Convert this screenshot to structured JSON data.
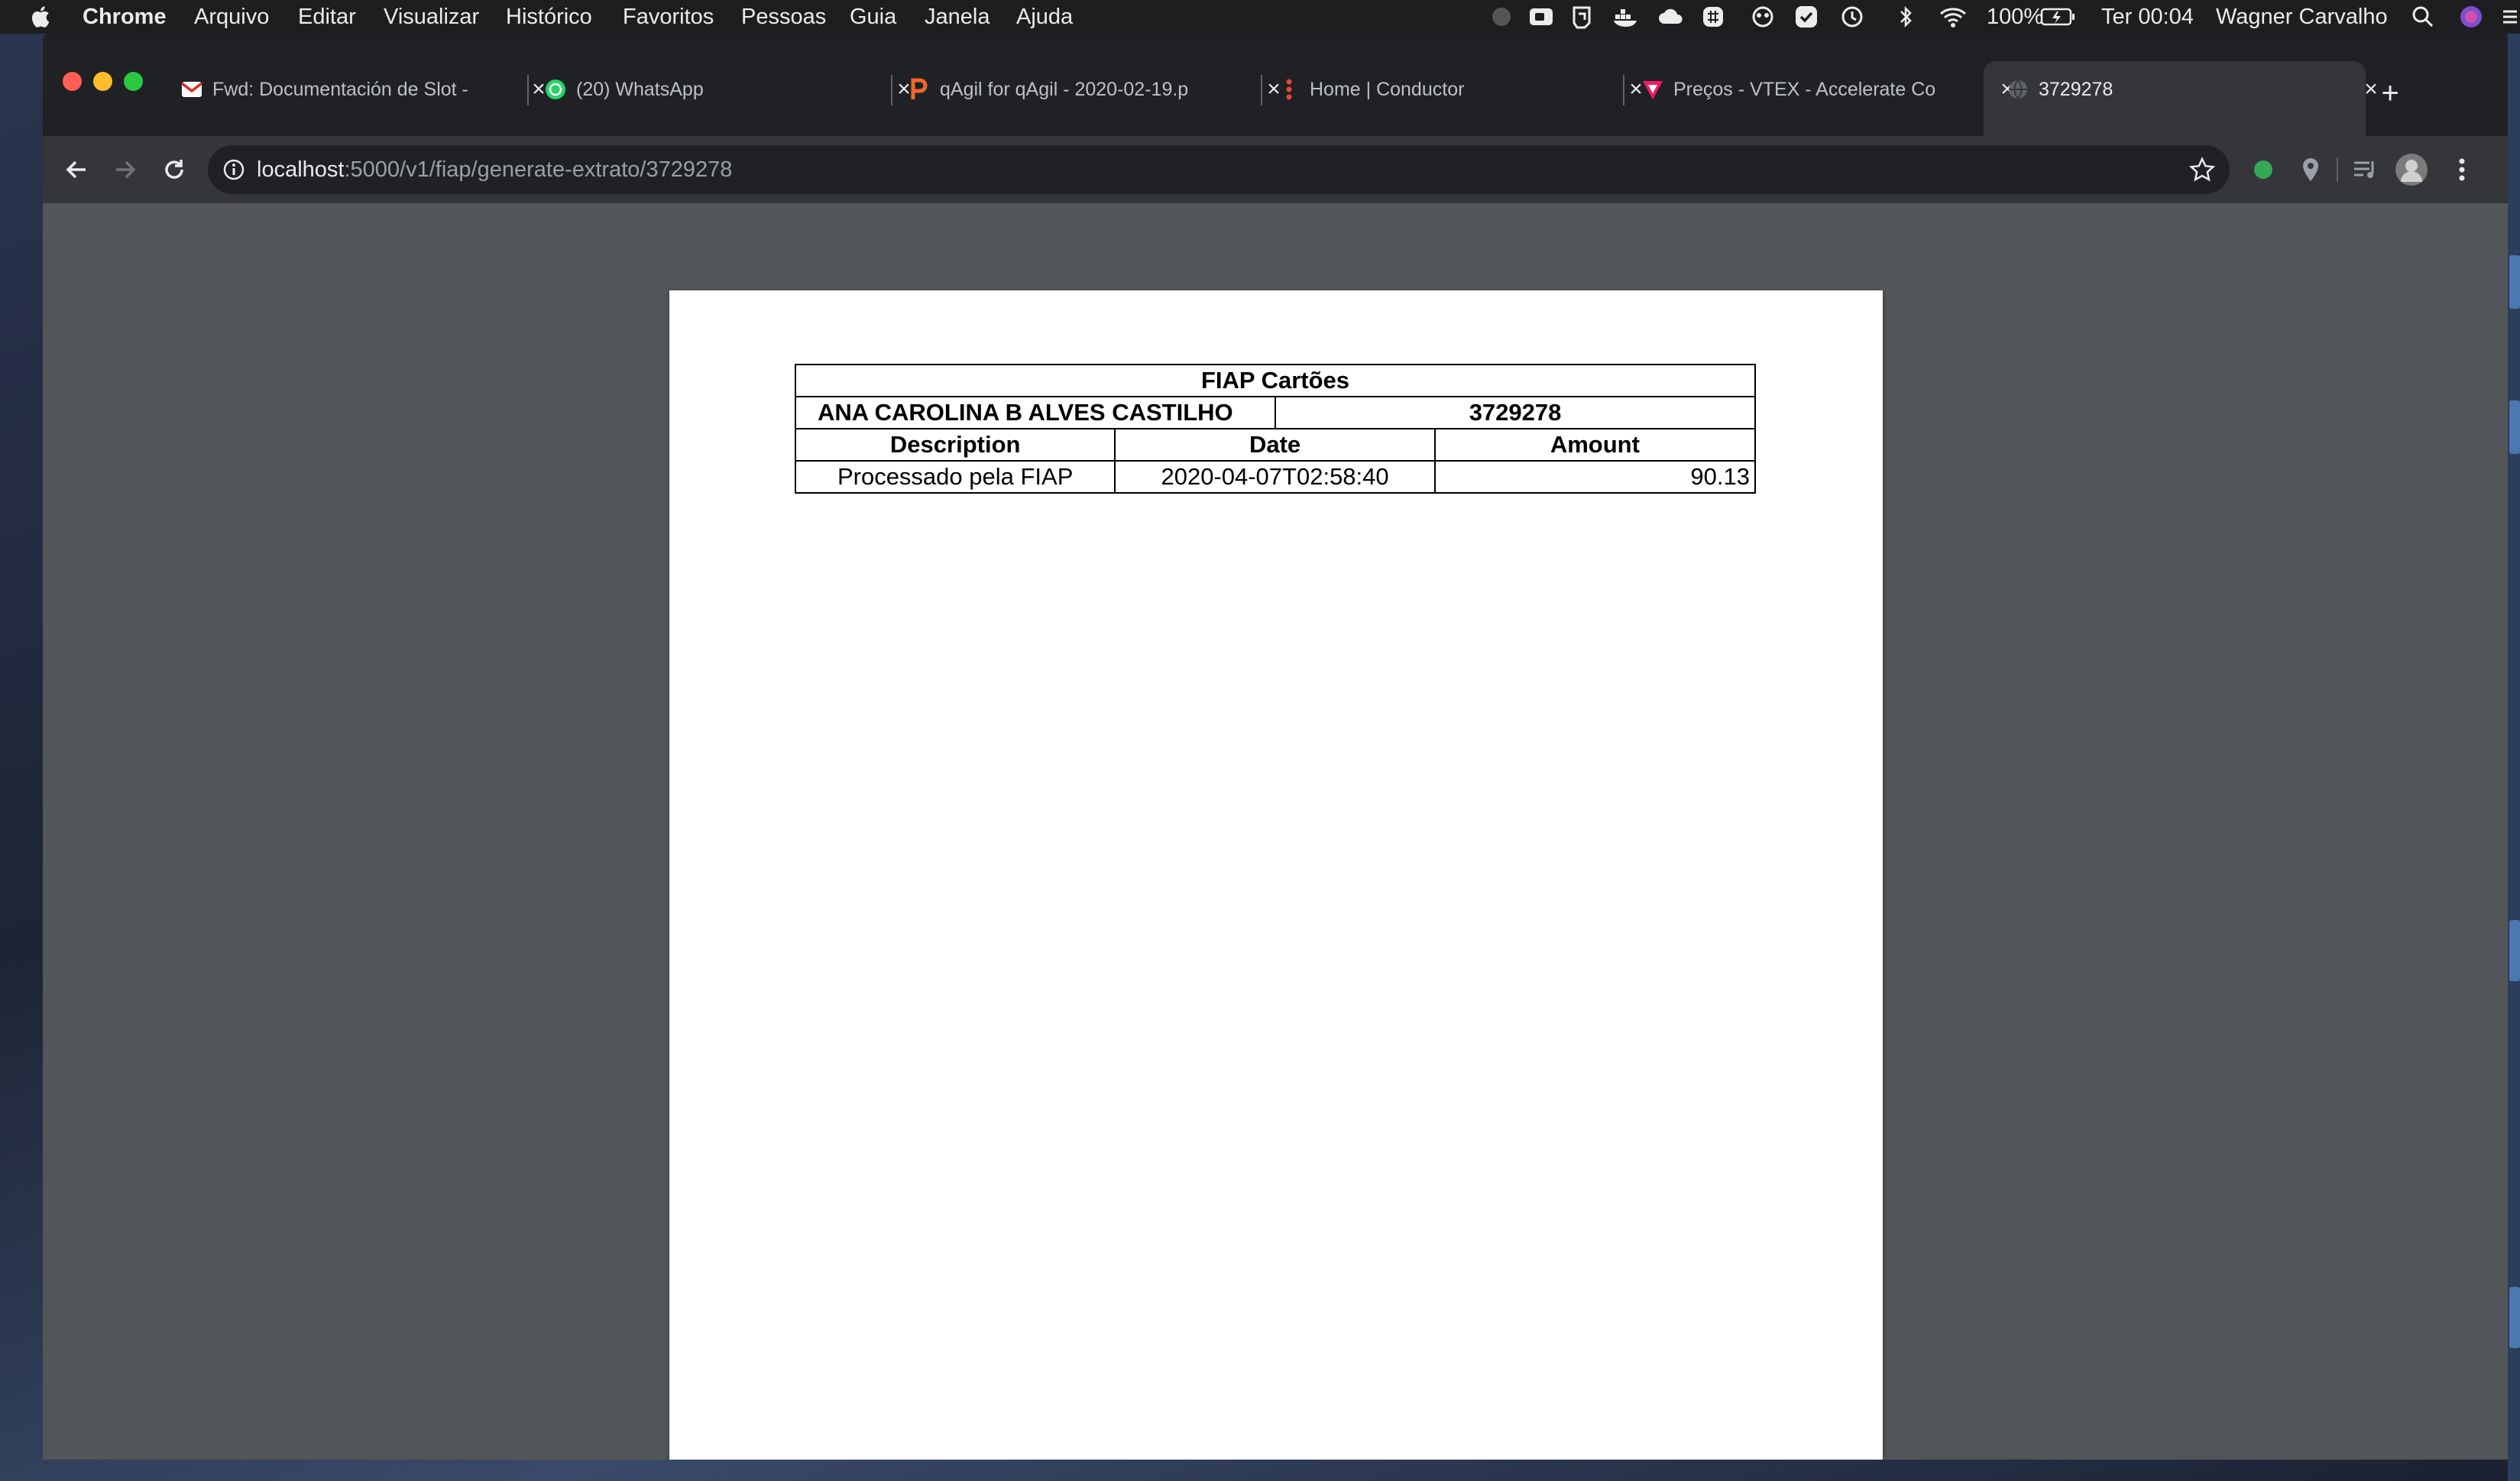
{
  "menubar": {
    "app_name": "Chrome",
    "menus": [
      "Arquivo",
      "Editar",
      "Visualizar",
      "Histórico",
      "Favoritos",
      "Pessoas",
      "Guia",
      "Janela",
      "Ajuda"
    ],
    "battery": "100%",
    "clock": "Ter 00:04",
    "user": "Wagner Carvalho"
  },
  "tabs": [
    {
      "title": "Fwd: Documentación de Slot -",
      "favicon": "gmail-icon"
    },
    {
      "title": "(20) WhatsApp",
      "favicon": "whatsapp-icon"
    },
    {
      "title": "qAgil for qAgil - 2020-02-19.p",
      "favicon": "p-letter-icon"
    },
    {
      "title": "Home | Conductor",
      "favicon": "conductor-icon"
    },
    {
      "title": "Preços - VTEX - Accelerate Co",
      "favicon": "vtex-icon"
    },
    {
      "title": "3729278",
      "favicon": "globe-icon"
    }
  ],
  "address_bar": {
    "host": "localhost",
    "path": ":5000/v1/fiap/generate-extrato/3729278"
  },
  "extrato": {
    "title": "FIAP Cartões",
    "customer_name": "ANA CAROLINA B ALVES CASTILHO",
    "account_number": "3729278",
    "columns": [
      "Description",
      "Date",
      "Amount"
    ],
    "rows": [
      {
        "description": "Processado pela FIAP",
        "date": "2020-04-07T02:58:40",
        "amount": "90.13"
      }
    ]
  },
  "colors": {
    "menubar_bg": "#1e1e20",
    "tabstrip_bg": "#202124",
    "toolbar_bg": "#35363a",
    "content_bg": "#525659",
    "page_bg": "#ffffff"
  }
}
